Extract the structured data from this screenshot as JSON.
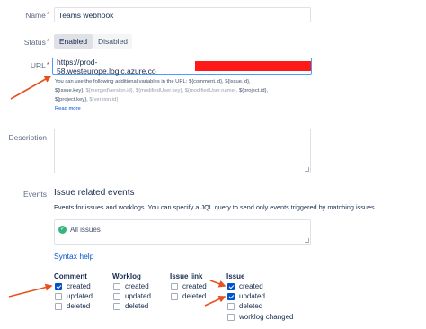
{
  "form": {
    "name": {
      "label": "Name",
      "required_mark": "*",
      "value": "Teams webhook"
    },
    "status": {
      "label": "Status",
      "required_mark": "*",
      "options": [
        "Enabled",
        "Disabled"
      ],
      "selected": "Enabled"
    },
    "url": {
      "label": "URL",
      "required_mark": "*",
      "value": "https://prod-58.westeurope.logic.azure.co",
      "redaction_color": "#ff1a1a",
      "help_line1": "You can use the following additional variables in the URL: ${comment.id}, ${issue.id},",
      "help_line2_a": "${issue.key}, ",
      "help_line2_b": "${mergedVersion.id}, ${modifiedUser.key}, ${modifiedUser.name},",
      "help_line2_c": " ${project.id},",
      "help_line3_a": "${project.key}, ",
      "help_line3_b": "${version.id}",
      "read_more": "Read more"
    },
    "description": {
      "label": "Description",
      "value": ""
    },
    "events": {
      "label": "Events",
      "title": "Issue related events",
      "help": "Events for issues and worklogs. You can specify a JQL query to send only events triggered by matching issues.",
      "jql_value": "All issues",
      "syntax_help": "Syntax help"
    }
  },
  "event_groups": {
    "comment": {
      "title": "Comment",
      "items": [
        {
          "label": "created",
          "checked": true
        },
        {
          "label": "updated",
          "checked": false
        },
        {
          "label": "deleted",
          "checked": false
        }
      ]
    },
    "worklog": {
      "title": "Worklog",
      "items": [
        {
          "label": "created",
          "checked": false
        },
        {
          "label": "updated",
          "checked": false
        },
        {
          "label": "deleted",
          "checked": false
        }
      ]
    },
    "issue_link": {
      "title": "Issue link",
      "items": [
        {
          "label": "created",
          "checked": false
        },
        {
          "label": "deleted",
          "checked": false
        }
      ]
    },
    "issue": {
      "title": "Issue",
      "items": [
        {
          "label": "created",
          "checked": true
        },
        {
          "label": "updated",
          "checked": true
        },
        {
          "label": "deleted",
          "checked": false
        },
        {
          "label": "worklog changed",
          "checked": false
        }
      ]
    }
  },
  "colors": {
    "accent": "#0052cc",
    "annotation_arrow": "#e8501f",
    "success": "#36b37e"
  },
  "icons": {
    "jql_status": "check-circle-icon",
    "annotation": "arrow-annotation-icon"
  }
}
